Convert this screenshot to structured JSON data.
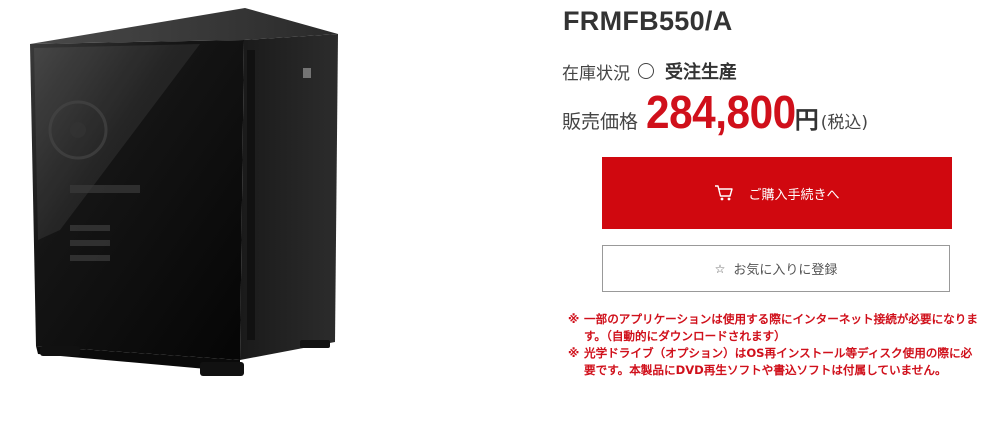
{
  "product": {
    "model": "FRMFB550/A",
    "image_alt": "PC case"
  },
  "stock": {
    "label": "在庫状況",
    "symbol": "○",
    "value": "受注生産"
  },
  "price": {
    "label": "販売価格",
    "value": "284,800",
    "unit": "円",
    "tax": "(税込)"
  },
  "actions": {
    "cart_label": "ご購入手続きへ",
    "favorite_label": "お気に入りに登録",
    "favorite_star": "☆"
  },
  "notes": [
    {
      "mark": "※",
      "text": "一部のアプリケーションは使用する際にインターネット接続が必要になります。（自動的にダウンロードされます）"
    },
    {
      "mark": "※",
      "text": "光学ドライブ（オプション）はOS再インストール等ディスク使用の際に必要です。本製品にDVD再生ソフトや書込ソフトは付属していません。"
    }
  ],
  "colors": {
    "accent": "#d0080f",
    "price": "#d0101b"
  },
  "icons": {
    "cart": "cart-icon",
    "star": "star-icon"
  }
}
